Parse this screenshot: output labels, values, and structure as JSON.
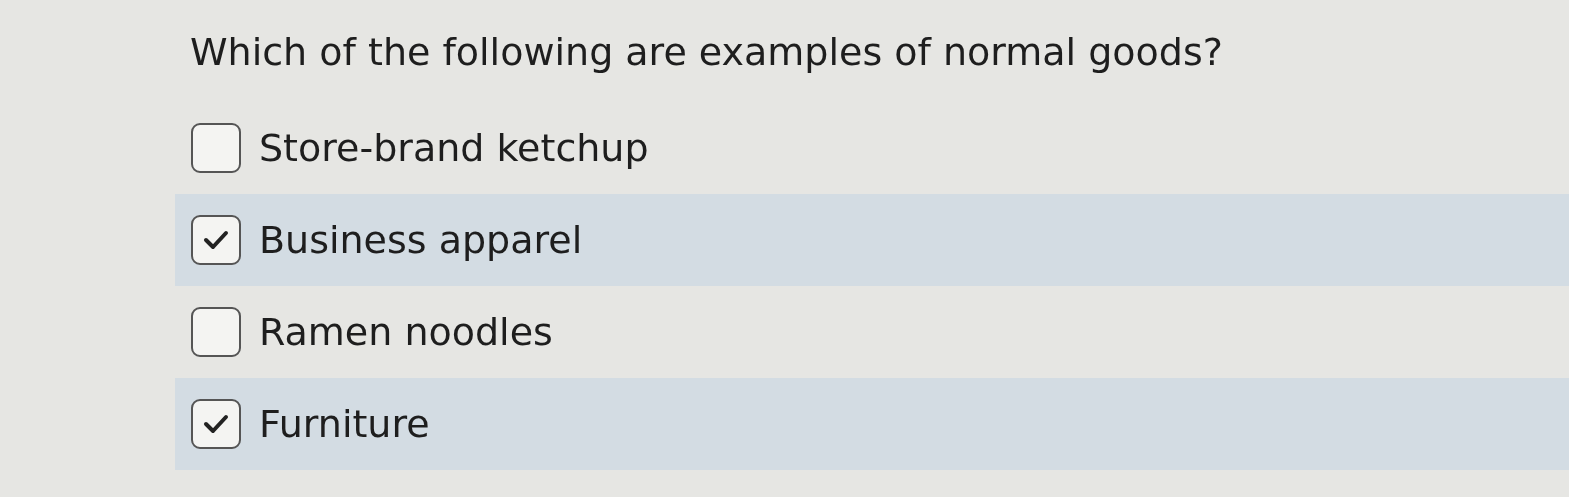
{
  "question": "Which of the following are examples of normal goods?",
  "options": [
    {
      "label": "Store-brand ketchup",
      "checked": false
    },
    {
      "label": "Business apparel",
      "checked": true
    },
    {
      "label": "Ramen noodles",
      "checked": false
    },
    {
      "label": "Furniture",
      "checked": true
    }
  ]
}
